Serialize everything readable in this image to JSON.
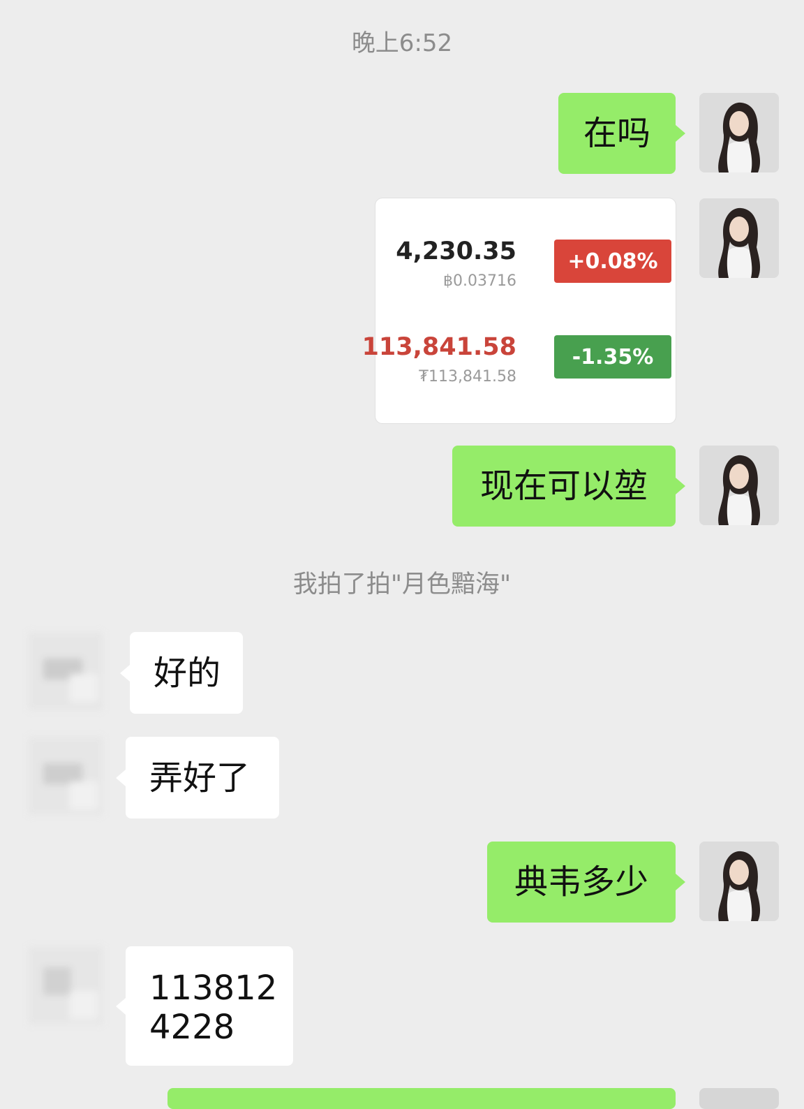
{
  "chat": {
    "timestamp": "晚上6:52",
    "system_message": "我拍了拍\"月色黯海\"",
    "messages": {
      "m1": "在吗",
      "m3": "现在可以堃",
      "m4": "好的",
      "m5": "弄好了",
      "m6": "典韦多少",
      "m7_line1": "113812",
      "m7_line2": "4228"
    }
  },
  "price_card": {
    "row1": {
      "price": "4,230.35",
      "sub": "฿0.03716",
      "change": "+0.08%"
    },
    "row2": {
      "price": "113,841.58",
      "sub": "₮113,841.58",
      "change": "-1.35%"
    }
  },
  "colors": {
    "outgoing_bubble": "#95ec69",
    "incoming_bubble": "#ffffff",
    "background": "#ededed",
    "up_badge": "#d9453a",
    "down_badge": "#48a04f",
    "red_price": "#c9443a"
  }
}
